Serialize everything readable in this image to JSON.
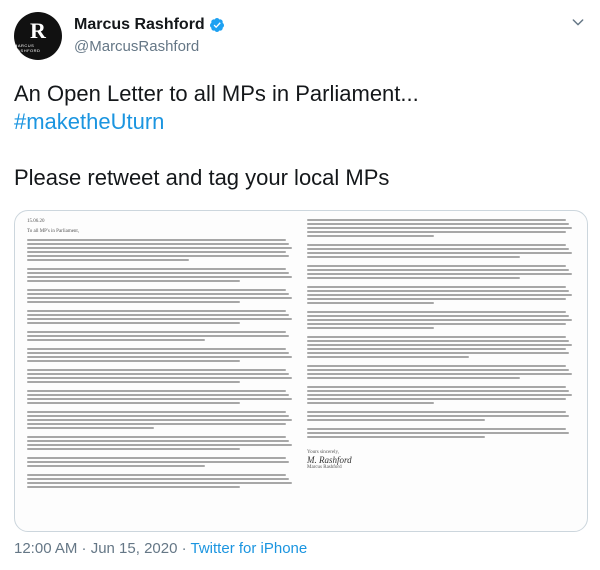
{
  "author": {
    "avatar_monogram": "R",
    "avatar_sub": "MARCUS RASHFORD",
    "display_name": "Marcus Rashford",
    "handle": "@MarcusRashford",
    "verified": true
  },
  "tweet": {
    "line1": "An Open Letter to all MPs in Parliament...",
    "hashtag": "#maketheUturn",
    "line3": "Please retweet and tag your local MPs"
  },
  "letter_image": {
    "date": "15.06.20",
    "salutation": "To all MP's in Parliament,",
    "signoff": "Yours sincerely,",
    "signature": "M. Rashford",
    "signer": "Marcus Rashford"
  },
  "meta": {
    "time": "12:00 AM · Jun 15, 2020",
    "separator": " · ",
    "source": "Twitter for iPhone"
  },
  "icons": {
    "verified": "verified-badge-icon",
    "caret": "chevron-down-icon"
  },
  "colors": {
    "link": "#1b95e0",
    "secondary_text": "#657786",
    "verified_badge": "#1da1f2"
  }
}
